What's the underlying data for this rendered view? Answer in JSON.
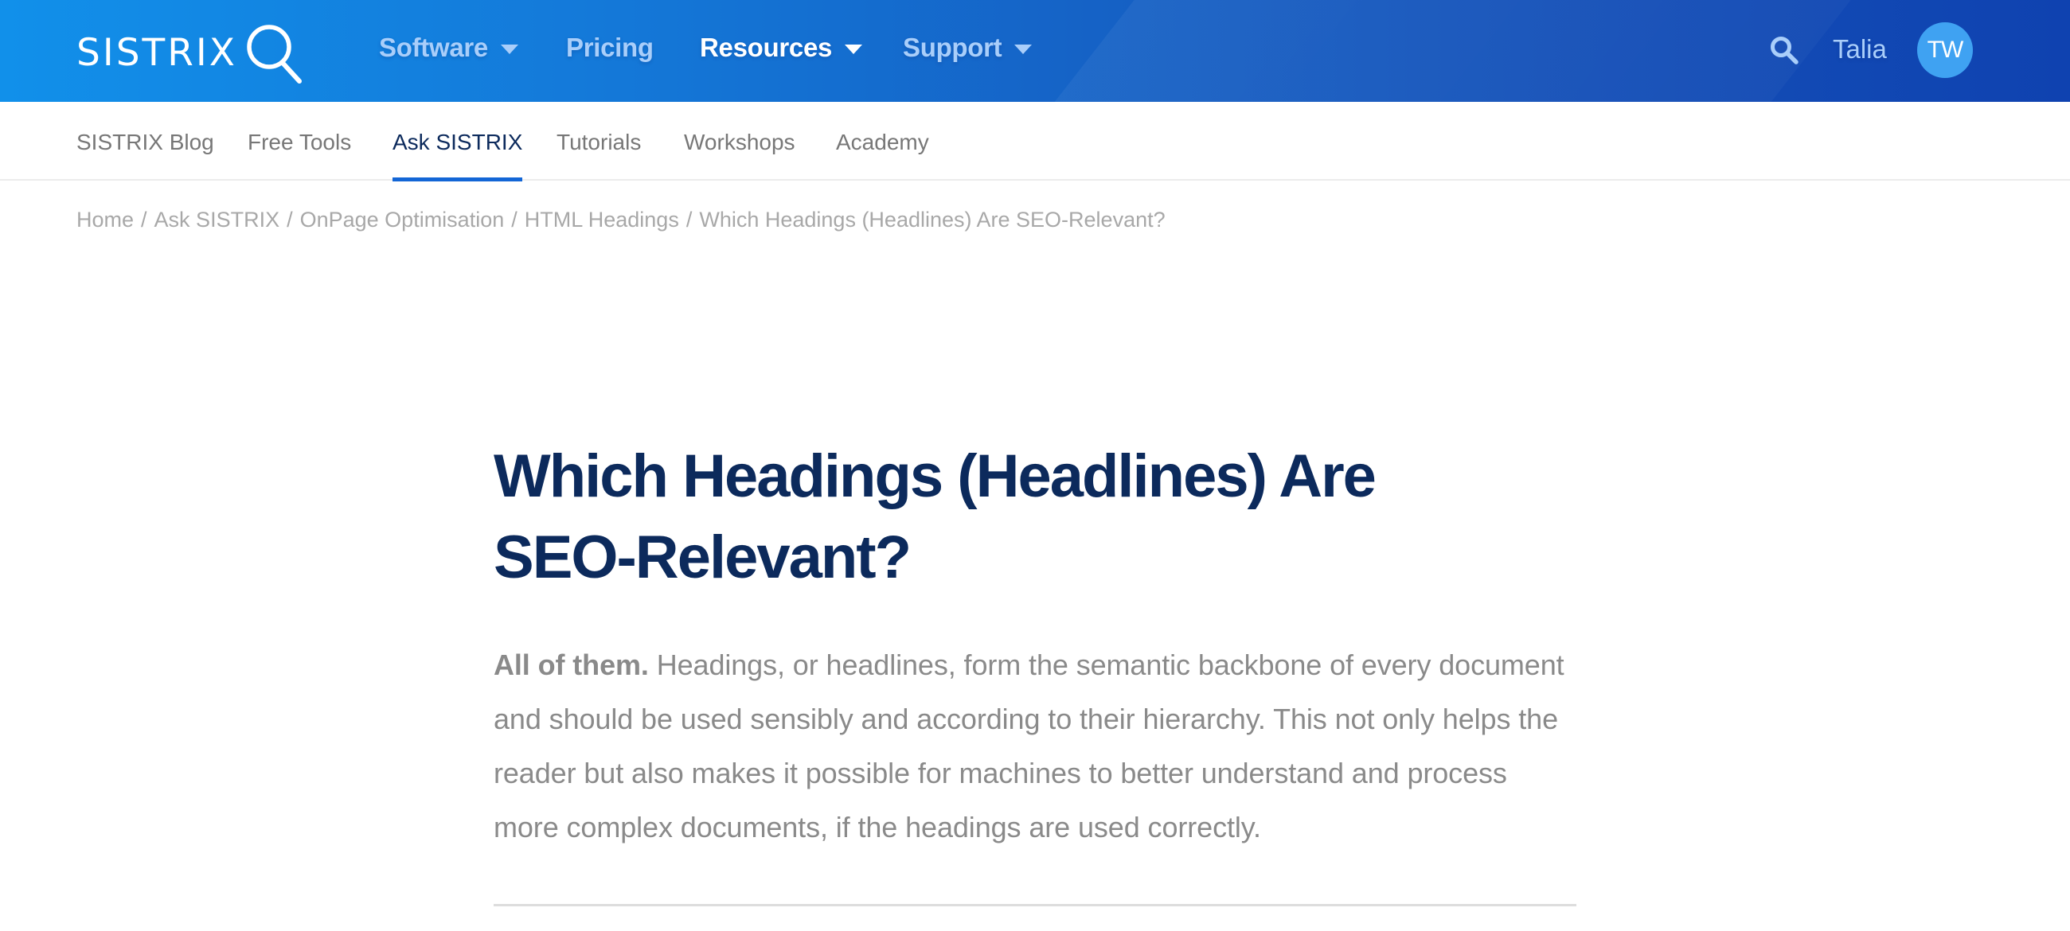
{
  "header": {
    "logo_text": "SISTRIX",
    "logo_icon": "magnifier-icon",
    "nav": [
      {
        "label": "Software",
        "has_dropdown": true,
        "active": false
      },
      {
        "label": "Pricing",
        "has_dropdown": false,
        "active": false
      },
      {
        "label": "Resources",
        "has_dropdown": true,
        "active": true
      },
      {
        "label": "Support",
        "has_dropdown": true,
        "active": false
      }
    ],
    "search_icon": "search-icon",
    "user_name": "Talia",
    "avatar_initials": "TW"
  },
  "subnav": {
    "items": [
      {
        "label": "SISTRIX Blog",
        "active": false
      },
      {
        "label": "Free Tools",
        "active": false
      },
      {
        "label": "Ask SISTRIX",
        "active": true
      },
      {
        "label": "Tutorials",
        "active": false
      },
      {
        "label": "Workshops",
        "active": false
      },
      {
        "label": "Academy",
        "active": false
      }
    ]
  },
  "breadcrumb": {
    "separator": "/",
    "items": [
      "Home",
      "Ask SISTRIX",
      "OnPage Optimisation",
      "HTML Headings",
      "Which Headings (Headlines) Are SEO-Relevant?"
    ]
  },
  "article": {
    "title": "Which Headings (Headlines) Are SEO-Relevant?",
    "lead_bold": "All of them.",
    "lead_text": " Headings, or headlines, form the semantic backbone of every document and should be used sensibly and according to their hierarchy. This not only helps the reader but also makes it possible for machines to better understand and process more complex documents, if the headings are used correctly."
  },
  "colors": {
    "header_gradient_start": "#1190ea",
    "header_gradient_end": "#0f42b0",
    "nav_text": "#a9cefa",
    "nav_active_text": "#ffffff",
    "avatar_bg": "#3fa2f2",
    "subnav_active_text": "#0c2a5c",
    "subnav_underline": "#1366d6",
    "title_color": "#0c2a5c",
    "body_text": "#8a8a8a",
    "breadcrumb_text": "#a8a8a8"
  }
}
